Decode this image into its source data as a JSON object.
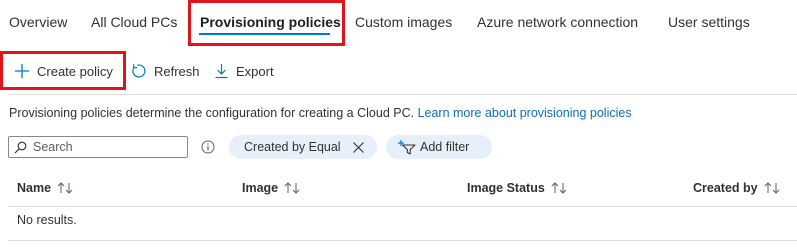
{
  "tabs": [
    {
      "label": "Overview"
    },
    {
      "label": "All Cloud PCs"
    },
    {
      "label": "Provisioning policies"
    },
    {
      "label": "Custom images"
    },
    {
      "label": "Azure network connection"
    },
    {
      "label": "User settings"
    }
  ],
  "active_tab": "Provisioning policies",
  "toolbar": {
    "create_label": "Create policy",
    "refresh_label": "Refresh",
    "export_label": "Export"
  },
  "description": {
    "text": "Provisioning policies determine the configuration for creating a Cloud PC.",
    "link": "Learn more about provisioning policies"
  },
  "filters": {
    "search_placeholder": "Search",
    "active_filter": "Created by Equal",
    "add_filter_label": "Add filter"
  },
  "table": {
    "columns": [
      "Name",
      "Image",
      "Image Status",
      "Created by"
    ],
    "empty_text": "No results."
  },
  "colors": {
    "accent": "#0078d4",
    "highlight": "#e3131b",
    "link": "#0f6cbd",
    "pill_bg": "#e7f0fa"
  }
}
